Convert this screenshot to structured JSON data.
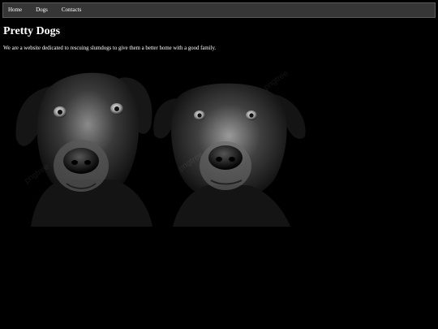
{
  "nav": {
    "items": [
      {
        "label": "Home"
      },
      {
        "label": "Dogs"
      },
      {
        "label": "Contacts"
      }
    ]
  },
  "main": {
    "title": "Pretty Dogs",
    "intro": "We are a website dedicated to rescuing slumdogs to give them a better home with a good family.",
    "image_subject": "two black dogs portrait, black and white photo"
  },
  "colors": {
    "background": "#000000",
    "navbar": "#363636",
    "text": "#ffffff"
  }
}
